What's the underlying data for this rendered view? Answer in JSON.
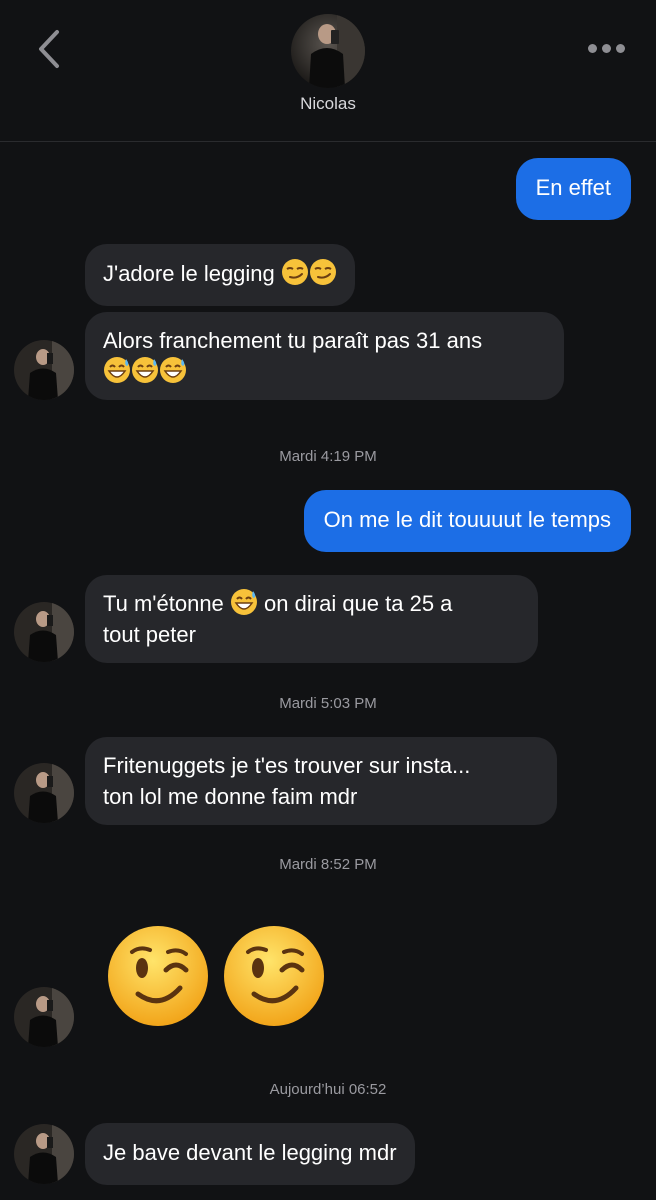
{
  "header": {
    "name": "Nicolas",
    "back_icon": "chevron-left-icon",
    "more_icon": "more-horizontal-icon"
  },
  "colors": {
    "background": "#111214",
    "incoming_bubble": "#26272b",
    "outgoing_bubble": "#1c6ee6",
    "timestamp": "#9a9aa0"
  },
  "messages": {
    "m1": {
      "text": "En effet"
    },
    "m2": {
      "text": "J'adore le legging",
      "emoji": "smirk-emoji"
    },
    "m3": {
      "line1": "Alors franchement tu paraît pas 31 ans",
      "emoji": "grin-sweat-emoji"
    },
    "ts1": "Mardi 4:19 PM",
    "m4": {
      "text": "On me le dit touuuut le temps"
    },
    "m5": {
      "before": "Tu m'étonne",
      "after": "on dirai que ta 25 a",
      "line2": "tout peter",
      "emoji": "grin-sweat-emoji"
    },
    "ts2": "Mardi 5:03 PM",
    "m6": {
      "line1": "Fritenuggets je t'es trouver sur insta...",
      "line2": "ton lol me donne faim mdr"
    },
    "ts3": "Mardi 8:52 PM",
    "m7": {
      "emoji": "winking-face-emoji"
    },
    "ts4": "Aujourd’hui 06:52",
    "m8": {
      "text": "Je bave devant le legging mdr"
    }
  }
}
